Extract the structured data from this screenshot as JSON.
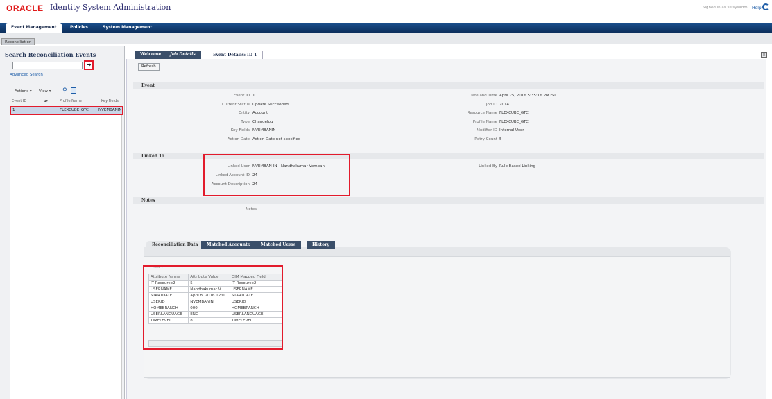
{
  "header": {
    "brand": "ORACLE",
    "title": "Identity System Administration",
    "signed_in": "Signed in as xelsysadm",
    "help": "Help"
  },
  "nav": {
    "tabs": [
      "Event Management",
      "Policies",
      "System Management"
    ],
    "subtab": "Reconciliation"
  },
  "left": {
    "title": "Search Reconciliation Events",
    "search_value": "",
    "go_label": "→",
    "advanced_search": "Advanced Search",
    "actions_label": "Actions ▾",
    "view_label": "View ▾",
    "columns": [
      "Event ID",
      "▴▾",
      "Profile Name",
      "Key Fields"
    ],
    "row": {
      "event_id": "1",
      "profile_name": "FLEXCUBE_GTC",
      "key_fields": "NVEMBANIN"
    }
  },
  "main": {
    "tabs": [
      "Welcome",
      "Job Details",
      "Event Details: ID 1"
    ],
    "refresh_label": "Refresh",
    "event": {
      "section": "Event",
      "left": [
        {
          "label": "Event ID",
          "value": "1"
        },
        {
          "label": "Current Status",
          "value": "Update Succeeded"
        },
        {
          "label": "Entity",
          "value": "Account"
        },
        {
          "label": "Type",
          "value": "Changelog"
        },
        {
          "label": "Key Fields",
          "value": "NVEMBANIN"
        },
        {
          "label": "Action Date",
          "value": "Action Date not specified"
        }
      ],
      "right": [
        {
          "label": "Date and Time",
          "value": "April 25, 2016 5:35:16 PM IST"
        },
        {
          "label": "Job ID",
          "value": "7014"
        },
        {
          "label": "Resource Name",
          "value": "FLEXCUBE_GTC"
        },
        {
          "label": "Profile Name",
          "value": "FLEXCUBE_GTC"
        },
        {
          "label": "Modifier ID",
          "value": "Internal User"
        },
        {
          "label": "Retry Count",
          "value": "5"
        }
      ]
    },
    "linked": {
      "section": "Linked To",
      "left": [
        {
          "label": "Linked User",
          "value": "NVEMBAN-IN - Nandhakumar Vemban"
        },
        {
          "label": "Linked Account ID",
          "value": "24"
        },
        {
          "label": "Account Description",
          "value": "24"
        }
      ],
      "right": [
        {
          "label": "Linked By",
          "value": "Rule Based Linking"
        }
      ]
    },
    "notes": {
      "section": "Notes",
      "label": "Notes"
    },
    "recon_tabs": [
      "Reconciliation Data",
      "Matched Accounts",
      "Matched Users",
      "History"
    ],
    "view_label": "View ▾",
    "attr_table": {
      "headers": [
        "Attribute Name",
        "Attribute Value",
        "OIM Mapped Field"
      ],
      "rows": [
        [
          "IT Resource2",
          "5",
          "IT Resource2"
        ],
        [
          "USERNAME",
          "Nandhakumar V",
          "USERNAME"
        ],
        [
          "STARTDATE",
          "April 8, 2016 12:0...",
          "STARTDATE"
        ],
        [
          "USERID",
          "NVEMBANIN",
          "USERID"
        ],
        [
          "HOMEBRANCH",
          "000",
          "HOMEBRANCH"
        ],
        [
          "USERLANGUAGE",
          "ENG",
          "USERLANGUAGE"
        ],
        [
          "TIMELEVEL",
          "8",
          "TIMELEVEL"
        ]
      ]
    }
  },
  "colors": {
    "brand": "#e01a1a",
    "nav": "#1b4f8c",
    "highlight": "#e21b2c",
    "link": "#1f5ea8"
  }
}
